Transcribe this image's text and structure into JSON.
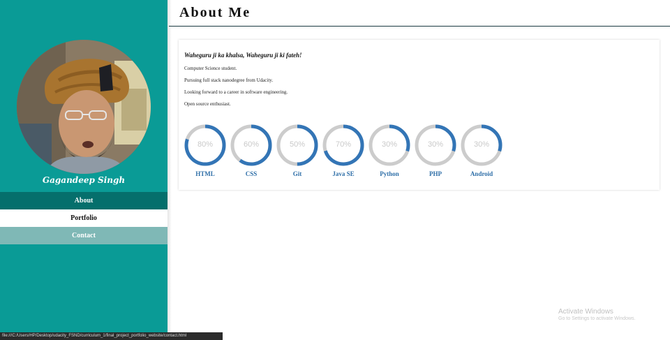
{
  "sidebar": {
    "profile_name": "Gagandeep Singh",
    "nav": [
      {
        "label": "About",
        "state": "active"
      },
      {
        "label": "Portfolio",
        "state": "normal"
      },
      {
        "label": "Contact",
        "state": "normal"
      }
    ]
  },
  "header": {
    "title": "About Me"
  },
  "about": {
    "motto": "Waheguru ji ka khalsa, Waheguru ji ki fateh!",
    "lines": [
      "Computer Science student.",
      "Pursuing full stack nanodegree from Udacity.",
      "Looking forward to a career in software engineering.",
      "Open source enthusiast."
    ]
  },
  "skills": [
    {
      "name": "HTML",
      "percent_label": "80%",
      "value": 80
    },
    {
      "name": "CSS",
      "percent_label": "60%",
      "value": 60
    },
    {
      "name": "Git",
      "percent_label": "50%",
      "value": 50
    },
    {
      "name": "Java SE",
      "percent_label": "70%",
      "value": 70
    },
    {
      "name": "Python",
      "percent_label": "30%",
      "value": 30
    },
    {
      "name": "PHP",
      "percent_label": "30%",
      "value": 30
    },
    {
      "name": "Android",
      "percent_label": "30%",
      "value": 30
    }
  ],
  "watermark": {
    "title": "Activate Windows",
    "subtitle": "Go to Settings to activate Windows."
  },
  "statusbar": {
    "url": "file:///C:/Users/HP/Desktop/udacity_FSND/curriculum_1/final_project_portfolio_website/contact.html"
  },
  "colors": {
    "sidebar": "#0a9b96",
    "nav_active": "#056f6c",
    "nav_contact": "#7fb8b6",
    "progress": "#3375b6",
    "progress_track": "#cccccc",
    "skill_label": "#2f6fa8"
  }
}
